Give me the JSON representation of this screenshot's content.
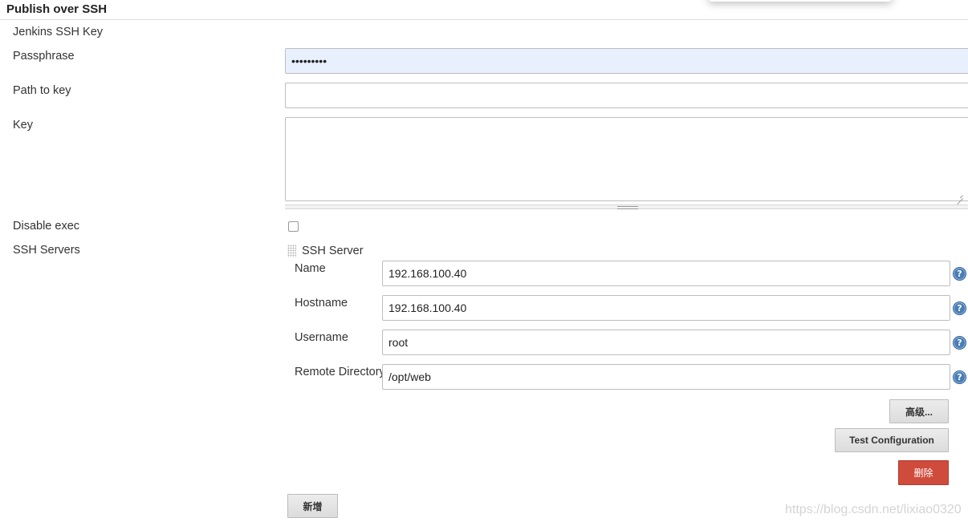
{
  "section": {
    "title": "Publish over SSH"
  },
  "fields": {
    "jenkins_ssh_key_label": "Jenkins SSH Key",
    "passphrase_label": "Passphrase",
    "passphrase_value": "•••••••••",
    "path_to_key_label": "Path to key",
    "path_to_key_value": "",
    "key_label": "Key",
    "key_value": "",
    "disable_exec_label": "Disable exec",
    "disable_exec_checked": false,
    "ssh_servers_label": "SSH Servers"
  },
  "ssh_server": {
    "header": "SSH Server",
    "name_label": "Name",
    "name_value": "192.168.100.40",
    "hostname_label": "Hostname",
    "hostname_value": "192.168.100.40",
    "username_label": "Username",
    "username_value": "root",
    "remote_directory_label": "Remote Directory",
    "remote_directory_value": "/opt/web",
    "help_glyph": "?",
    "advanced_button": "高级...",
    "test_button": "Test Configuration",
    "delete_button": "删除"
  },
  "add_button": "新增",
  "watermark": "https://blog.csdn.net/lixiao0320",
  "icons": {
    "help": "help-icon",
    "drag": "drag-handle-icon",
    "resize": "resize-grip-icon"
  },
  "colors": {
    "delete_button": "#cf4b3b",
    "help_icon": "#4a7db5",
    "autofill_bg": "#e8f0fe"
  }
}
